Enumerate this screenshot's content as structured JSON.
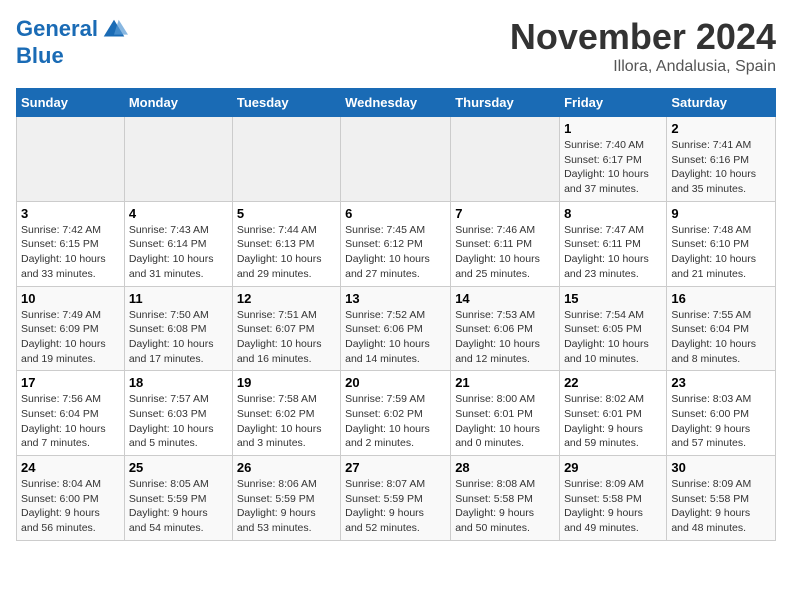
{
  "header": {
    "logo_line1": "General",
    "logo_line2": "Blue",
    "month": "November 2024",
    "location": "Illora, Andalusia, Spain"
  },
  "days_of_week": [
    "Sunday",
    "Monday",
    "Tuesday",
    "Wednesday",
    "Thursday",
    "Friday",
    "Saturday"
  ],
  "weeks": [
    [
      {
        "day": "",
        "info": ""
      },
      {
        "day": "",
        "info": ""
      },
      {
        "day": "",
        "info": ""
      },
      {
        "day": "",
        "info": ""
      },
      {
        "day": "",
        "info": ""
      },
      {
        "day": "1",
        "info": "Sunrise: 7:40 AM\nSunset: 6:17 PM\nDaylight: 10 hours\nand 37 minutes."
      },
      {
        "day": "2",
        "info": "Sunrise: 7:41 AM\nSunset: 6:16 PM\nDaylight: 10 hours\nand 35 minutes."
      }
    ],
    [
      {
        "day": "3",
        "info": "Sunrise: 7:42 AM\nSunset: 6:15 PM\nDaylight: 10 hours\nand 33 minutes."
      },
      {
        "day": "4",
        "info": "Sunrise: 7:43 AM\nSunset: 6:14 PM\nDaylight: 10 hours\nand 31 minutes."
      },
      {
        "day": "5",
        "info": "Sunrise: 7:44 AM\nSunset: 6:13 PM\nDaylight: 10 hours\nand 29 minutes."
      },
      {
        "day": "6",
        "info": "Sunrise: 7:45 AM\nSunset: 6:12 PM\nDaylight: 10 hours\nand 27 minutes."
      },
      {
        "day": "7",
        "info": "Sunrise: 7:46 AM\nSunset: 6:11 PM\nDaylight: 10 hours\nand 25 minutes."
      },
      {
        "day": "8",
        "info": "Sunrise: 7:47 AM\nSunset: 6:11 PM\nDaylight: 10 hours\nand 23 minutes."
      },
      {
        "day": "9",
        "info": "Sunrise: 7:48 AM\nSunset: 6:10 PM\nDaylight: 10 hours\nand 21 minutes."
      }
    ],
    [
      {
        "day": "10",
        "info": "Sunrise: 7:49 AM\nSunset: 6:09 PM\nDaylight: 10 hours\nand 19 minutes."
      },
      {
        "day": "11",
        "info": "Sunrise: 7:50 AM\nSunset: 6:08 PM\nDaylight: 10 hours\nand 17 minutes."
      },
      {
        "day": "12",
        "info": "Sunrise: 7:51 AM\nSunset: 6:07 PM\nDaylight: 10 hours\nand 16 minutes."
      },
      {
        "day": "13",
        "info": "Sunrise: 7:52 AM\nSunset: 6:06 PM\nDaylight: 10 hours\nand 14 minutes."
      },
      {
        "day": "14",
        "info": "Sunrise: 7:53 AM\nSunset: 6:06 PM\nDaylight: 10 hours\nand 12 minutes."
      },
      {
        "day": "15",
        "info": "Sunrise: 7:54 AM\nSunset: 6:05 PM\nDaylight: 10 hours\nand 10 minutes."
      },
      {
        "day": "16",
        "info": "Sunrise: 7:55 AM\nSunset: 6:04 PM\nDaylight: 10 hours\nand 8 minutes."
      }
    ],
    [
      {
        "day": "17",
        "info": "Sunrise: 7:56 AM\nSunset: 6:04 PM\nDaylight: 10 hours\nand 7 minutes."
      },
      {
        "day": "18",
        "info": "Sunrise: 7:57 AM\nSunset: 6:03 PM\nDaylight: 10 hours\nand 5 minutes."
      },
      {
        "day": "19",
        "info": "Sunrise: 7:58 AM\nSunset: 6:02 PM\nDaylight: 10 hours\nand 3 minutes."
      },
      {
        "day": "20",
        "info": "Sunrise: 7:59 AM\nSunset: 6:02 PM\nDaylight: 10 hours\nand 2 minutes."
      },
      {
        "day": "21",
        "info": "Sunrise: 8:00 AM\nSunset: 6:01 PM\nDaylight: 10 hours\nand 0 minutes."
      },
      {
        "day": "22",
        "info": "Sunrise: 8:02 AM\nSunset: 6:01 PM\nDaylight: 9 hours\nand 59 minutes."
      },
      {
        "day": "23",
        "info": "Sunrise: 8:03 AM\nSunset: 6:00 PM\nDaylight: 9 hours\nand 57 minutes."
      }
    ],
    [
      {
        "day": "24",
        "info": "Sunrise: 8:04 AM\nSunset: 6:00 PM\nDaylight: 9 hours\nand 56 minutes."
      },
      {
        "day": "25",
        "info": "Sunrise: 8:05 AM\nSunset: 5:59 PM\nDaylight: 9 hours\nand 54 minutes."
      },
      {
        "day": "26",
        "info": "Sunrise: 8:06 AM\nSunset: 5:59 PM\nDaylight: 9 hours\nand 53 minutes."
      },
      {
        "day": "27",
        "info": "Sunrise: 8:07 AM\nSunset: 5:59 PM\nDaylight: 9 hours\nand 52 minutes."
      },
      {
        "day": "28",
        "info": "Sunrise: 8:08 AM\nSunset: 5:58 PM\nDaylight: 9 hours\nand 50 minutes."
      },
      {
        "day": "29",
        "info": "Sunrise: 8:09 AM\nSunset: 5:58 PM\nDaylight: 9 hours\nand 49 minutes."
      },
      {
        "day": "30",
        "info": "Sunrise: 8:09 AM\nSunset: 5:58 PM\nDaylight: 9 hours\nand 48 minutes."
      }
    ]
  ]
}
